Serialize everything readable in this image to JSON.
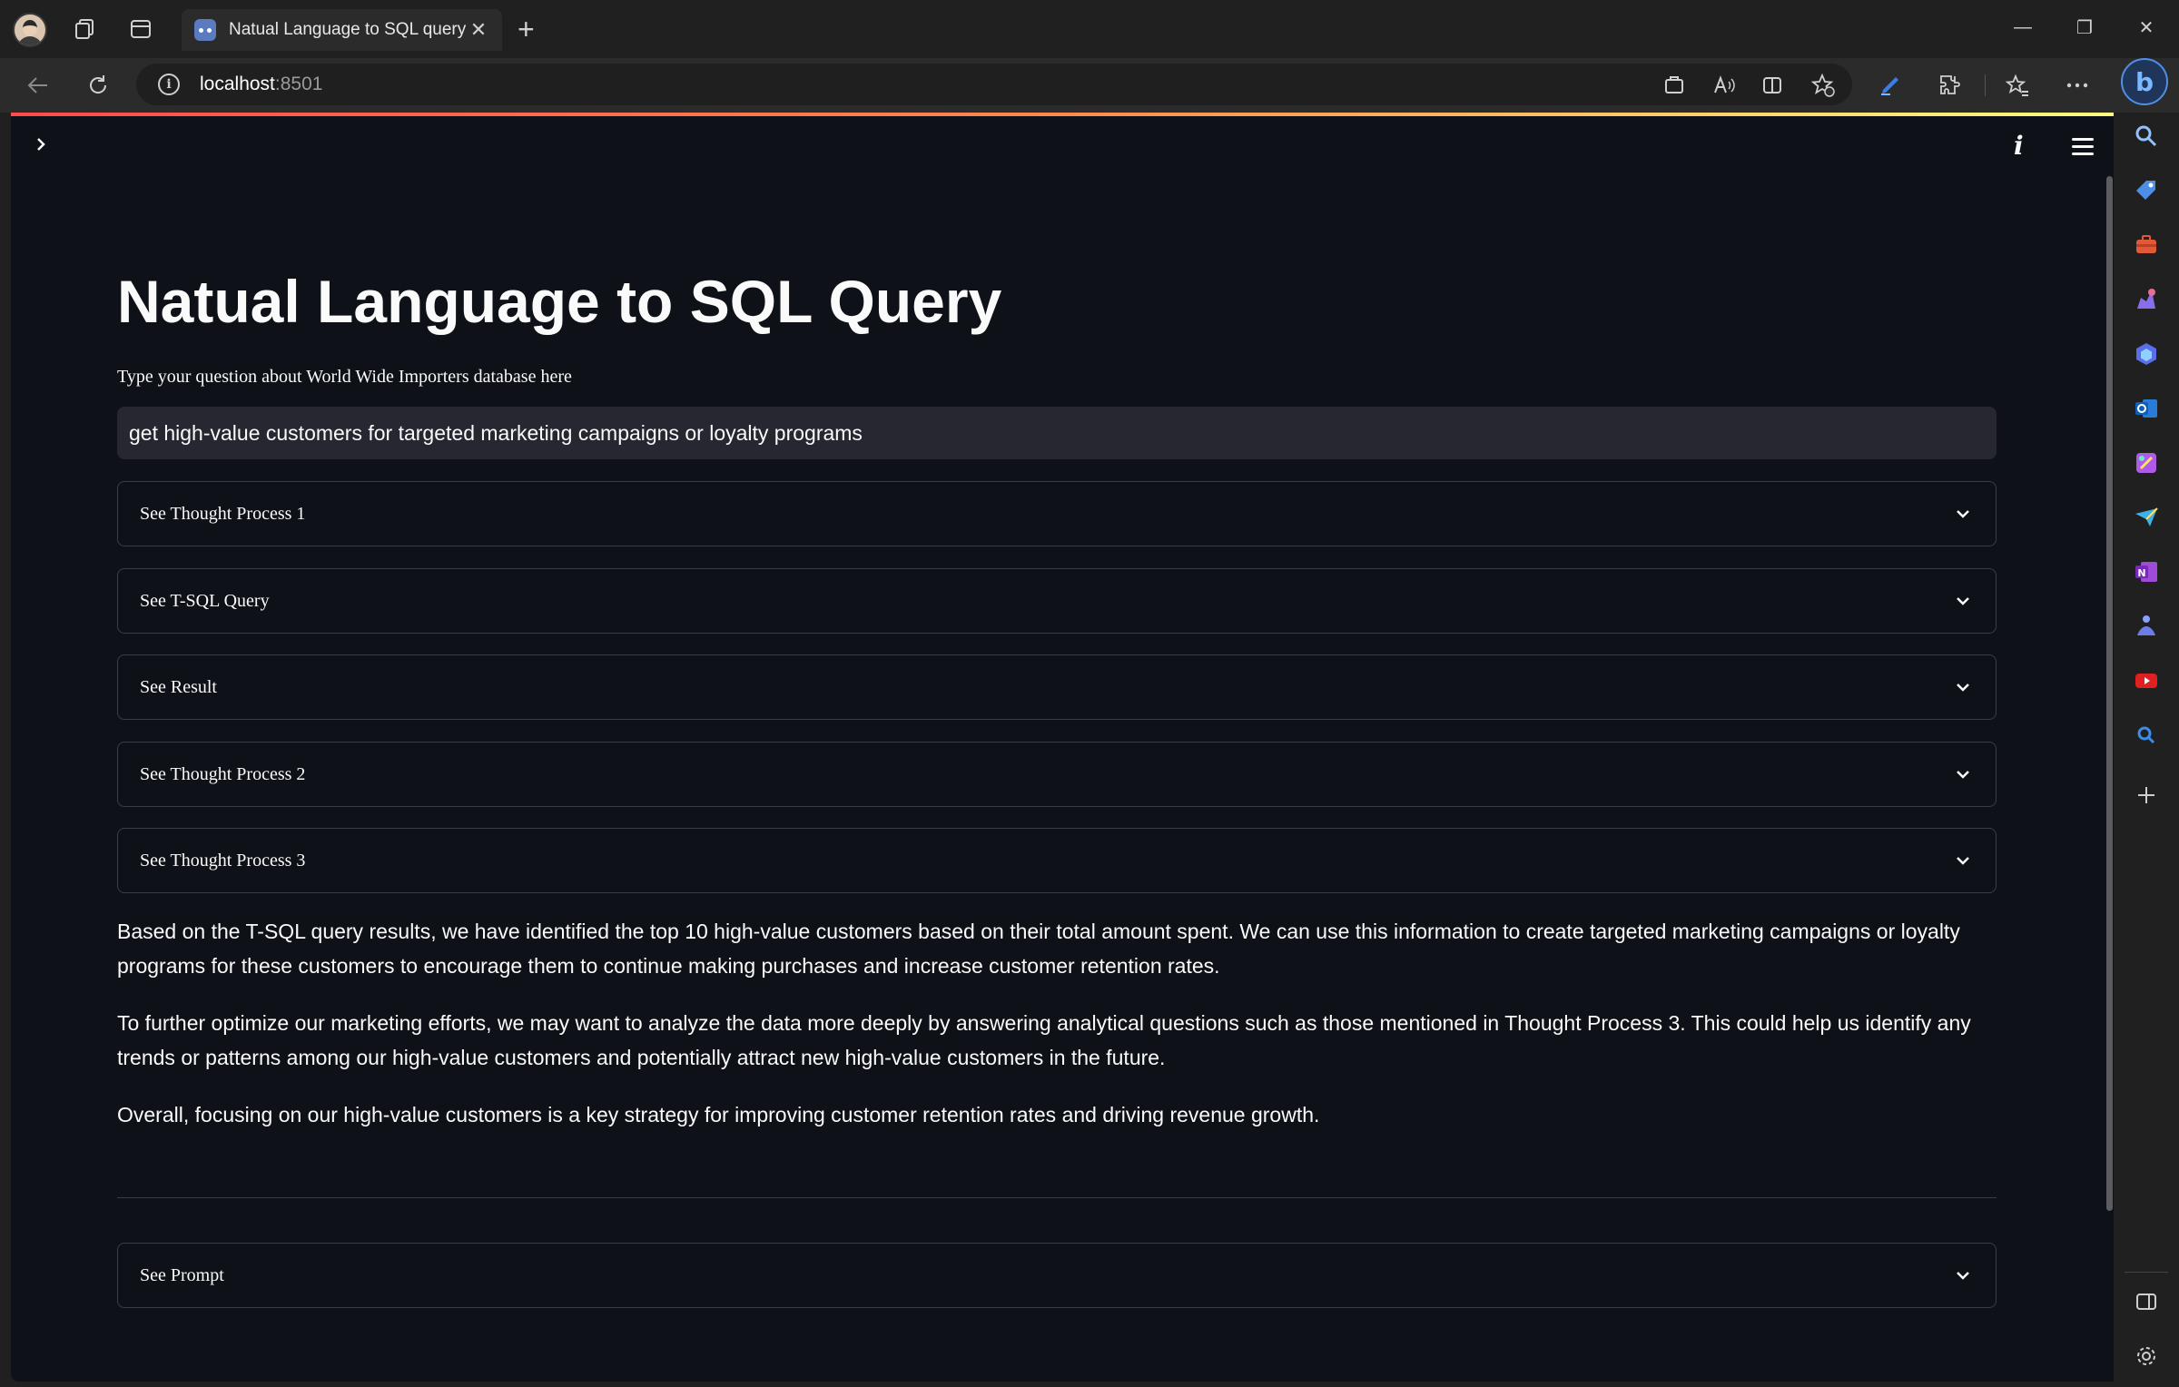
{
  "browser": {
    "tab_title": "Natual Language to SQL query",
    "tab_close": "✕",
    "new_tab": "+",
    "url_host": "localhost",
    "url_port": ":8501",
    "info_glyph": "i",
    "bing_glyph": "b",
    "window_controls": [
      "—",
      "❐",
      "✕"
    ]
  },
  "app": {
    "title": "Natual Language to SQL Query",
    "input_label": "Type your question about World Wide Importers database here",
    "input_value": "get high-value customers for targeted marketing campaigns or loyalty programs",
    "expanders": [
      {
        "label": "See Thought Process 1"
      },
      {
        "label": "See T-SQL Query"
      },
      {
        "label": "See Result"
      },
      {
        "label": "See Thought Process 2"
      },
      {
        "label": "See Thought Process 3"
      }
    ],
    "paragraphs": [
      "Based on the T-SQL query results, we have identified the top 10 high-value customers based on their total amount spent. We can use this information to create targeted marketing campaigns or loyalty programs for these customers to encourage them to continue making purchases and increase customer retention rates.",
      "To further optimize our marketing efforts, we may want to analyze the data more deeply by answering analytical questions such as those mentioned in Thought Process 3. This could help us identify any trends or patterns among our high-value customers and potentially attract new high-value customers in the future.",
      "Overall, focusing on our high-value customers is a key strategy for improving customer retention rates and driving revenue growth."
    ],
    "prompt_expander": {
      "label": "See Prompt"
    },
    "info_glyph": "i",
    "sidebar_toggle_glyph": "›"
  },
  "colors": {
    "page_bg": "#0e1117",
    "input_bg": "#262730",
    "border": "#3b3d45",
    "accent_gradient": [
      "#ff4b4b",
      "#fd8a4e",
      "#fffd80"
    ]
  },
  "sidebar_icons": [
    "search-icon",
    "shopping-tag-icon",
    "tools-icon",
    "games-icon",
    "copilot-icon",
    "outlook-icon",
    "designer-icon",
    "telegram-icon",
    "onenote-icon",
    "meditation-icon",
    "youtube-icon",
    "bing-search-icon",
    "add-icon",
    "split-screen-icon",
    "settings-icon"
  ]
}
